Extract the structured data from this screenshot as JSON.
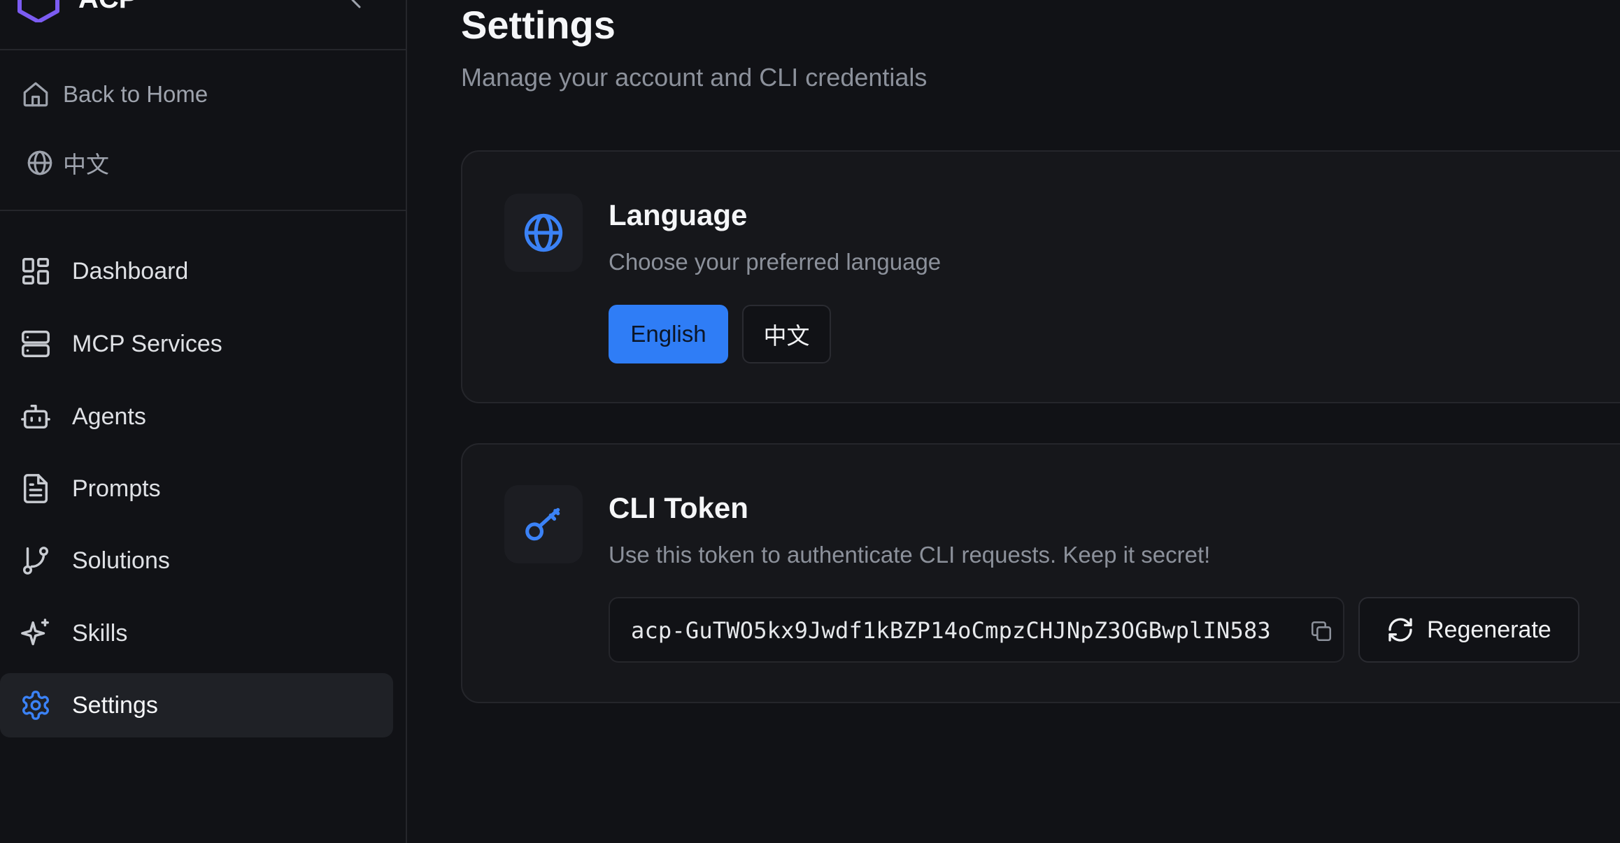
{
  "brand": {
    "name": "ACP",
    "accent": "#7c5cf2"
  },
  "utility": [
    {
      "label": "Back to Home",
      "icon": "home-icon"
    },
    {
      "label": "中文",
      "icon": "globe-icon"
    }
  ],
  "nav": [
    {
      "label": "Dashboard",
      "icon": "dashboard-icon"
    },
    {
      "label": "MCP Services",
      "icon": "server-icon"
    },
    {
      "label": "Agents",
      "icon": "bot-icon"
    },
    {
      "label": "Prompts",
      "icon": "file-text-icon"
    },
    {
      "label": "Solutions",
      "icon": "git-branch-icon"
    },
    {
      "label": "Skills",
      "icon": "sparkles-icon"
    },
    {
      "label": "Settings",
      "icon": "gear-icon",
      "active": true
    }
  ],
  "page": {
    "title": "Settings",
    "subtitle": "Manage your account and CLI credentials"
  },
  "language_card": {
    "title": "Language",
    "description": "Choose your preferred language",
    "options": [
      "English",
      "中文"
    ],
    "selected": "English"
  },
  "token_card": {
    "title": "CLI Token",
    "description": "Use this token to authenticate CLI requests. Keep it secret!",
    "token": "acp-GuTWO5kx9Jwdf1kBZP14oCmpzCHJNpZ3OGBwplIN583",
    "regenerate_label": "Regenerate"
  },
  "colors": {
    "background": "#111216",
    "card": "#16171b",
    "primary": "#2f7df6",
    "muted_text": "#8c919b"
  }
}
